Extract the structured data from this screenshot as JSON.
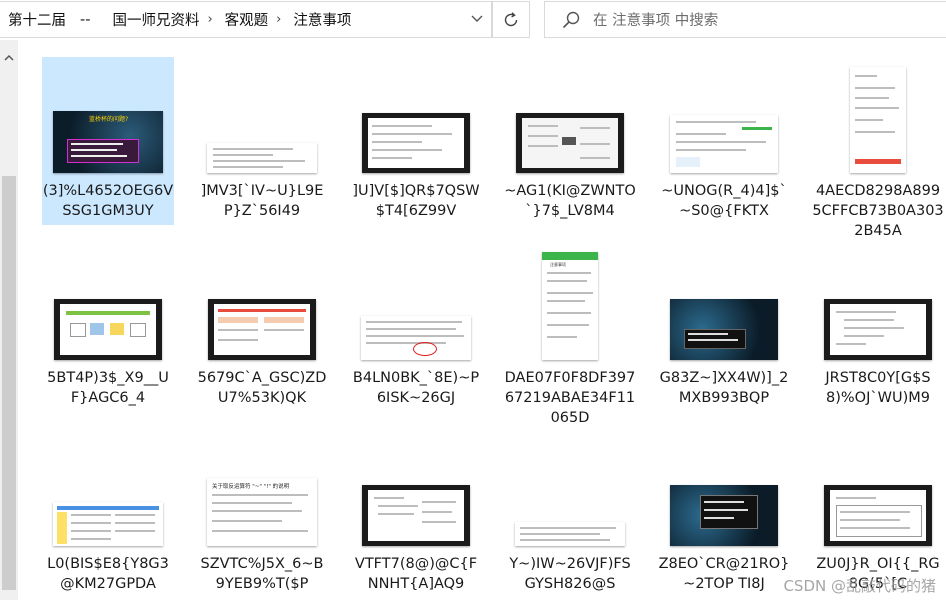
{
  "breadcrumb": {
    "items": [
      "第十二届",
      "国一师兄资料",
      "客观题",
      "注意事项"
    ],
    "dash": "--"
  },
  "search": {
    "placeholder": "在 注意事项 中搜索"
  },
  "files": [
    {
      "name": "(3]%L4652OEG6VSSG1GM3UY",
      "selected": true
    },
    {
      "name": "]MV3[`IV~U}L9EP}Z`56I49"
    },
    {
      "name": "]U]V[$]QR$7QSW$T4[6Z99V"
    },
    {
      "name": "~AG1(KI@ZWNTO`}7$_LV8M4"
    },
    {
      "name": "~UNOG(R_4)4]$`~S0@{FKTX"
    },
    {
      "name": "4AECD8298A8995CFFCB73B0A3032B45A"
    },
    {
      "name": "5BT4P)3$_X9__UF}AGC6_4"
    },
    {
      "name": "5679C`A_GSC)ZDU7%53K)QK"
    },
    {
      "name": "B4LN0BK_`8E)~P6ISK~26GJ"
    },
    {
      "name": "DAE07F0F8DF39767219ABAE34F11065D"
    },
    {
      "name": "G83Z~]XX4W)]_2MXB993BQP"
    },
    {
      "name": "JRST8C0Y[G$S8)%OJ`WU)M9"
    },
    {
      "name": "L0(BIS$E8{Y8G3@KM27GPDA"
    },
    {
      "name": "SZVTC%J5X_6~B9YEB9%T($P"
    },
    {
      "name": "VTFT7(8@)@C{FNNHT{A]AQ9"
    },
    {
      "name": "Y~)IW~26VJF)FSGYSH826@S"
    },
    {
      "name": "Z8EO`CR@21RO}~2TOP TI8J"
    },
    {
      "name": "ZU0J}R_OI{{_RG 8G(5`[C"
    }
  ],
  "thumb_text": {
    "slide_title": "蓝桥杯的问题?",
    "doc_heading": "关于取反运算符 \"~\" \"!\" 的说明",
    "phone_title": "注意事项"
  },
  "watermark": "CSDN @乱敲代码的猪"
}
